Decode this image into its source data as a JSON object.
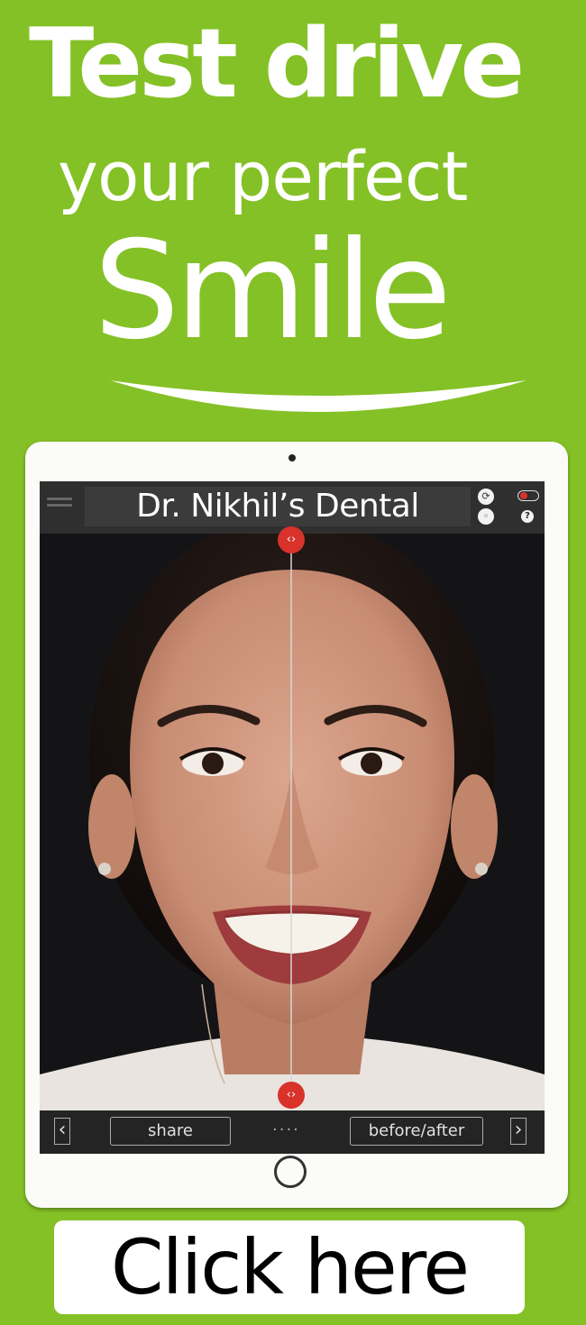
{
  "headline": {
    "line1": "Test drive",
    "line2": "your perfect",
    "line3": "Smile"
  },
  "tablet": {
    "app_title": "Dr. Nikhil’s Dental",
    "icons": [
      "menu-icon",
      "sync-icon",
      "toggle-icon",
      "settings-icon",
      "help-icon",
      "slider-handle-icon",
      "chevron-left-icon",
      "chevron-right-icon",
      "home-button-icon",
      "camera-icon"
    ],
    "help_glyph": "?",
    "handle_glyph": "‹›",
    "prev_glyph": "‹",
    "next_glyph": "›",
    "share_label": "share",
    "dots": "····",
    "before_after_label": "before/after"
  },
  "cta": {
    "label": "Click here"
  },
  "colors": {
    "background": "#84c126",
    "handle": "#d8322b",
    "screen": "#1a1a1a"
  }
}
